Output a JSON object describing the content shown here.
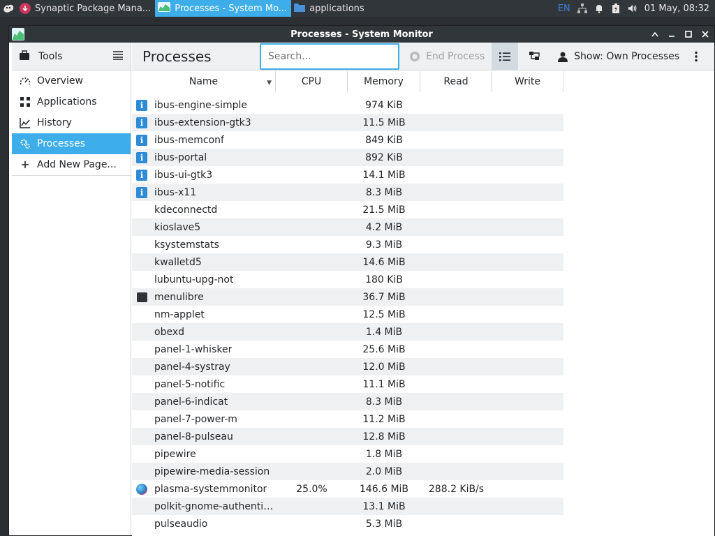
{
  "taskbar": {
    "tasks": [
      {
        "label": "Synaptic Package Mana...",
        "active": false
      },
      {
        "label": "Processes - System Mo...",
        "active": true
      },
      {
        "label": "applications",
        "active": false
      }
    ],
    "tray": {
      "keyboard_layout": "EN",
      "clock": "01 May, 08:32"
    }
  },
  "window": {
    "title": "Processes - System Monitor"
  },
  "sidebar": {
    "header_label": "Tools",
    "items": [
      {
        "label": "Overview",
        "icon": "overview-gauge-icon",
        "selected": false
      },
      {
        "label": "Applications",
        "icon": "applications-grid-icon",
        "selected": false
      },
      {
        "label": "History",
        "icon": "history-chart-icon",
        "selected": false
      },
      {
        "label": "Processes",
        "icon": "processes-gears-icon",
        "selected": true
      },
      {
        "label": "Add New Page...",
        "icon": "plus-icon",
        "selected": false
      }
    ]
  },
  "toolbar": {
    "page_title": "Processes",
    "search_placeholder": "Search...",
    "end_process_label": "End Process",
    "show_filter_label": "Show: Own Processes"
  },
  "table": {
    "columns": [
      "Name",
      "CPU",
      "Memory",
      "Read",
      "Write"
    ],
    "rows": [
      {
        "name": "ibus-engine-simple",
        "icon": "info",
        "cpu": "",
        "memory": "974 KiB",
        "read": "",
        "write": ""
      },
      {
        "name": "ibus-extension-gtk3",
        "icon": "info",
        "cpu": "",
        "memory": "11.5 MiB",
        "read": "",
        "write": ""
      },
      {
        "name": "ibus-memconf",
        "icon": "info",
        "cpu": "",
        "memory": "849 KiB",
        "read": "",
        "write": ""
      },
      {
        "name": "ibus-portal",
        "icon": "info",
        "cpu": "",
        "memory": "892 KiB",
        "read": "",
        "write": ""
      },
      {
        "name": "ibus-ui-gtk3",
        "icon": "info",
        "cpu": "",
        "memory": "14.1 MiB",
        "read": "",
        "write": ""
      },
      {
        "name": "ibus-x11",
        "icon": "info",
        "cpu": "",
        "memory": "8.3 MiB",
        "read": "",
        "write": ""
      },
      {
        "name": "kdeconnectd",
        "icon": "",
        "cpu": "",
        "memory": "21.5 MiB",
        "read": "",
        "write": ""
      },
      {
        "name": "kioslave5",
        "icon": "",
        "cpu": "",
        "memory": "4.2 MiB",
        "read": "",
        "write": ""
      },
      {
        "name": "ksystemstats",
        "icon": "",
        "cpu": "",
        "memory": "9.3 MiB",
        "read": "",
        "write": ""
      },
      {
        "name": "kwalletd5",
        "icon": "",
        "cpu": "",
        "memory": "14.6 MiB",
        "read": "",
        "write": ""
      },
      {
        "name": "lubuntu-upg-not",
        "icon": "",
        "cpu": "",
        "memory": "180 KiB",
        "read": "",
        "write": ""
      },
      {
        "name": "menulibre",
        "icon": "chat",
        "cpu": "",
        "memory": "36.7 MiB",
        "read": "",
        "write": ""
      },
      {
        "name": "nm-applet",
        "icon": "",
        "cpu": "",
        "memory": "12.5 MiB",
        "read": "",
        "write": ""
      },
      {
        "name": "obexd",
        "icon": "",
        "cpu": "",
        "memory": "1.4 MiB",
        "read": "",
        "write": ""
      },
      {
        "name": "panel-1-whisker",
        "icon": "",
        "cpu": "",
        "memory": "25.6 MiB",
        "read": "",
        "write": ""
      },
      {
        "name": "panel-4-systray",
        "icon": "",
        "cpu": "",
        "memory": "12.0 MiB",
        "read": "",
        "write": ""
      },
      {
        "name": "panel-5-notific",
        "icon": "",
        "cpu": "",
        "memory": "11.1 MiB",
        "read": "",
        "write": ""
      },
      {
        "name": "panel-6-indicat",
        "icon": "",
        "cpu": "",
        "memory": "8.3 MiB",
        "read": "",
        "write": ""
      },
      {
        "name": "panel-7-power-m",
        "icon": "",
        "cpu": "",
        "memory": "11.2 MiB",
        "read": "",
        "write": ""
      },
      {
        "name": "panel-8-pulseau",
        "icon": "",
        "cpu": "",
        "memory": "12.8 MiB",
        "read": "",
        "write": ""
      },
      {
        "name": "pipewire",
        "icon": "",
        "cpu": "",
        "memory": "1.8 MiB",
        "read": "",
        "write": ""
      },
      {
        "name": "pipewire-media-session",
        "icon": "",
        "cpu": "",
        "memory": "2.0 MiB",
        "read": "",
        "write": ""
      },
      {
        "name": "plasma-systemmonitor",
        "icon": "globe",
        "cpu": "25.0%",
        "memory": "146.6 MiB",
        "read": "288.2 KiB/s",
        "write": ""
      },
      {
        "name": "polkit-gnome-authentic...",
        "icon": "",
        "cpu": "",
        "memory": "13.1 MiB",
        "read": "",
        "write": ""
      },
      {
        "name": "pulseaudio",
        "icon": "",
        "cpu": "",
        "memory": "5.3 MiB",
        "read": "",
        "write": ""
      }
    ]
  }
}
